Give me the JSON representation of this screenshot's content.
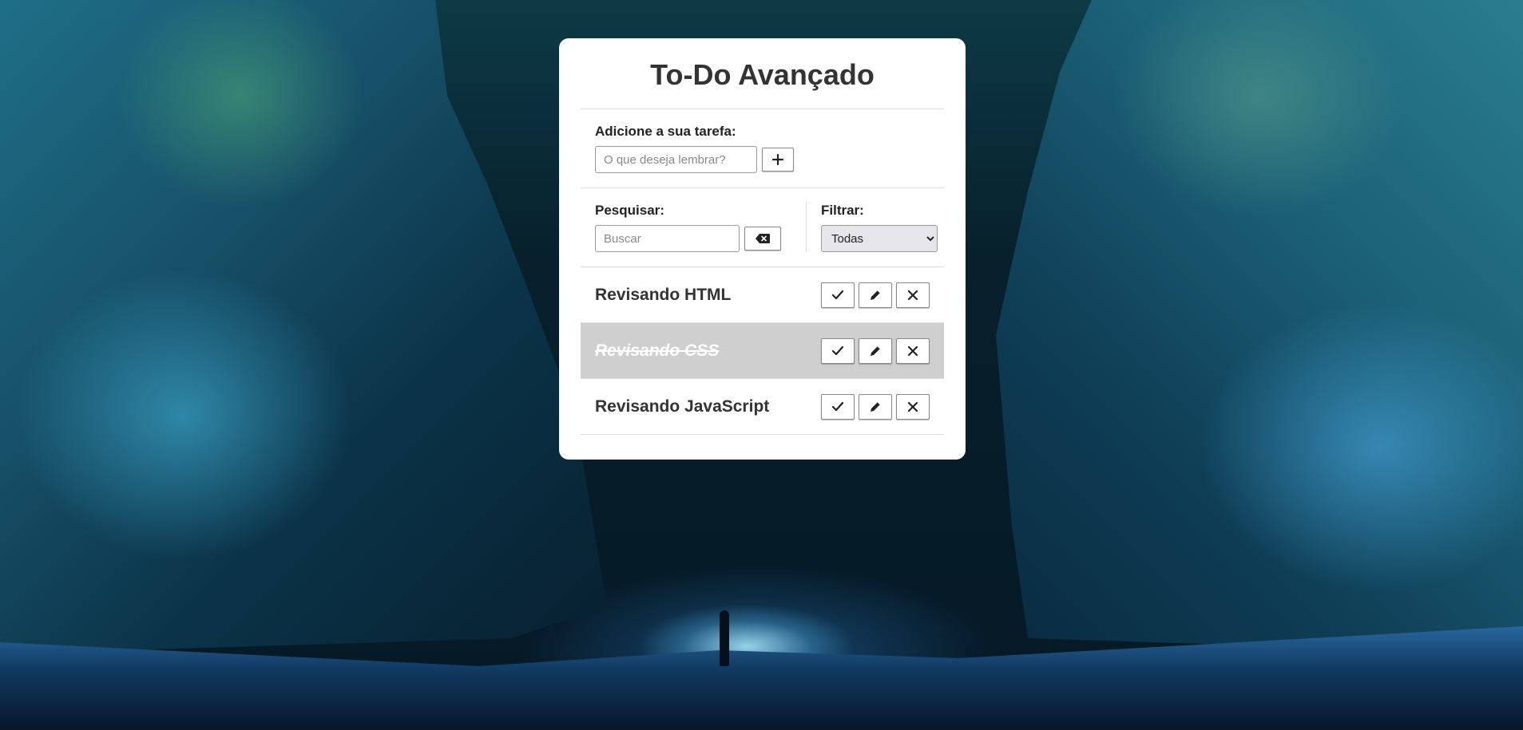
{
  "header": {
    "title": "To-Do Avançado"
  },
  "add_form": {
    "label": "Adicione a sua tarefa:",
    "placeholder": "O que deseja lembrar?",
    "add_icon": "plus-icon"
  },
  "search": {
    "label": "Pesquisar:",
    "placeholder": "Buscar",
    "clear_icon": "backspace-icon"
  },
  "filter": {
    "label": "Filtrar:",
    "selected": "Todas"
  },
  "todos": [
    {
      "text": "Revisando HTML",
      "done": false
    },
    {
      "text": "Revisando CSS",
      "done": true
    },
    {
      "text": "Revisando JavaScript",
      "done": false
    }
  ],
  "colors": {
    "card_bg": "#ffffff",
    "done_row_bg": "#cfcfcf",
    "text": "#333333"
  }
}
